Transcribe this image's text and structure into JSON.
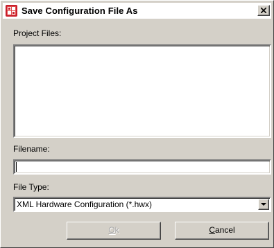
{
  "window": {
    "title": "Save Configuration File As",
    "icon": "app-grid-icon",
    "close": "close-icon"
  },
  "project_files": {
    "label": "Project Files:",
    "items": []
  },
  "filename": {
    "label": "Filename:",
    "value": ""
  },
  "file_type": {
    "label": "File Type:",
    "selected": "XML Hardware Configuration (*.hwx)",
    "arrow_icon": "chevron-down-icon"
  },
  "buttons": {
    "ok_mnemonic": "O",
    "ok_rest": "k",
    "ok_enabled": false,
    "cancel_mnemonic": "C",
    "cancel_rest": "ancel"
  },
  "colors": {
    "dialog_bg": "#d4d0c8",
    "disabled_text": "#a8a8a8",
    "icon_red": "#c81e2a"
  }
}
